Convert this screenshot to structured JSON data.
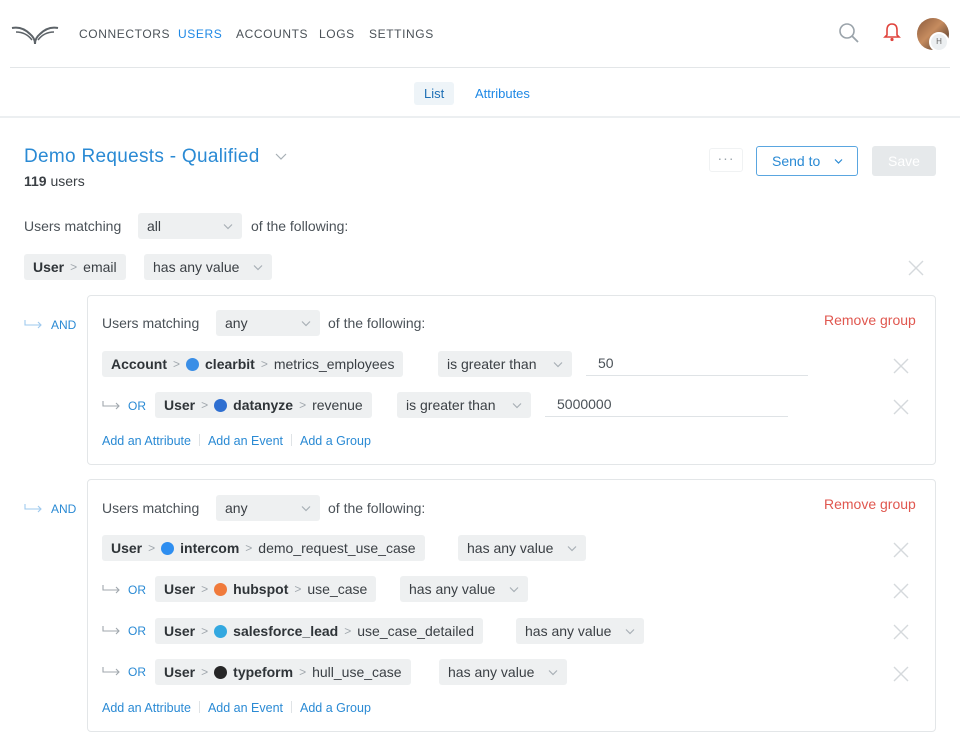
{
  "nav": {
    "links": [
      "CONNECTORS",
      "USERS",
      "ACCOUNTS",
      "LOGS",
      "SETTINGS"
    ],
    "active": "USERS",
    "avatar_badge": "H"
  },
  "subtabs": {
    "list": "List",
    "attributes": "Attributes",
    "active": "List"
  },
  "segment": {
    "title": "Demo Requests - Qualified",
    "count": "119",
    "count_suffix": "users",
    "more": "···",
    "send_to": "Send to",
    "save": "Save"
  },
  "root_filter": {
    "prefix": "Users matching",
    "match": "all",
    "suffix": "of the following:",
    "condition": {
      "entity": "User",
      "attribute": "email",
      "operator": "has any value"
    }
  },
  "group1": {
    "and_label": "AND",
    "prefix": "Users matching",
    "match": "any",
    "suffix": "of the following:",
    "remove": "Remove group",
    "conditions": [
      {
        "entity": "Account",
        "service": "clearbit",
        "attribute": "metrics_employees",
        "operator": "is greater than",
        "value": "50"
      },
      {
        "or_label": "OR",
        "entity": "User",
        "service": "datanyze",
        "attribute": "revenue",
        "operator": "is greater than",
        "value": "5000000"
      }
    ],
    "add_attribute": "Add an Attribute",
    "add_event": "Add an Event",
    "add_group": "Add a Group"
  },
  "group2": {
    "and_label": "AND",
    "prefix": "Users matching",
    "match": "any",
    "suffix": "of the following:",
    "remove": "Remove group",
    "conditions": [
      {
        "entity": "User",
        "service": "intercom",
        "attribute": "demo_request_use_case",
        "operator": "has any value"
      },
      {
        "or_label": "OR",
        "entity": "User",
        "service": "hubspot",
        "attribute": "use_case",
        "operator": "has any value"
      },
      {
        "or_label": "OR",
        "entity": "User",
        "service": "salesforce_lead",
        "attribute": "use_case_detailed",
        "operator": "has any value"
      },
      {
        "or_label": "OR",
        "entity": "User",
        "service": "typeform",
        "attribute": "hull_use_case",
        "operator": "has any value"
      }
    ],
    "add_attribute": "Add an Attribute",
    "add_event": "Add an Event",
    "add_group": "Add a Group"
  },
  "colors": {
    "accent": "#1e88e5",
    "danger": "#e0574f",
    "clearbit": "#3a8ee6",
    "datanyze": "#2f6fd1",
    "intercom": "#2e8ef0",
    "hubspot": "#f07a3b",
    "salesforce": "#33a8e0",
    "typeform": "#262627"
  }
}
